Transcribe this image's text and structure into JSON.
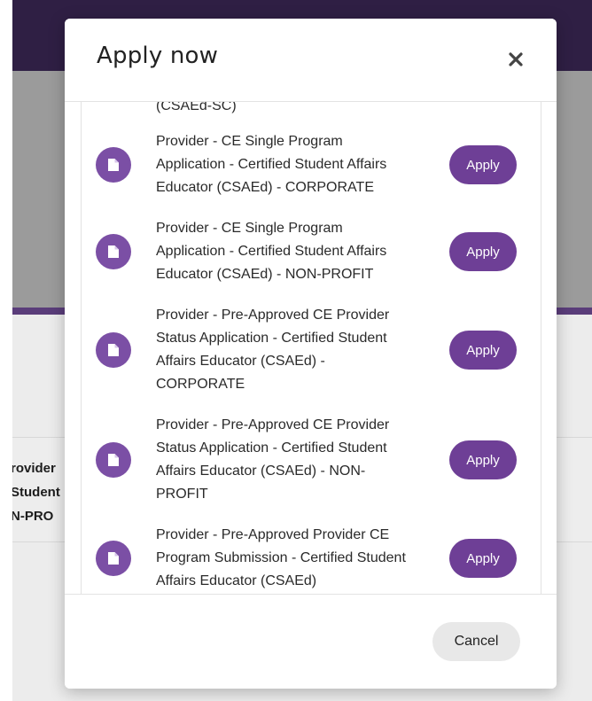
{
  "background": {
    "row_lines": [
      "rovider",
      "Student",
      "N-PRO"
    ]
  },
  "modal": {
    "title": "Apply now",
    "close_icon": "close-icon",
    "top_cut_text": "(CSAEd-SC)",
    "items": [
      {
        "icon": "document-icon",
        "lines": [
          "Provider - CE Single Program",
          "Application - Certified Student Affairs",
          "Educator (CSAEd) - CORPORATE"
        ],
        "button": "Apply"
      },
      {
        "icon": "document-icon",
        "lines": [
          "Provider - CE Single Program",
          "Application - Certified Student Affairs",
          "Educator (CSAEd) - NON-PROFIT"
        ],
        "button": "Apply"
      },
      {
        "icon": "document-icon",
        "lines": [
          "Provider - Pre-Approved CE Provider",
          "Status Application - Certified Student",
          "Affairs Educator (CSAEd) -",
          "CORPORATE"
        ],
        "button": "Apply"
      },
      {
        "icon": "document-icon",
        "lines": [
          "Provider - Pre-Approved CE Provider",
          "Status Application - Certified Student",
          "Affairs Educator (CSAEd) - NON-",
          "PROFIT"
        ],
        "button": "Apply"
      },
      {
        "icon": "document-icon",
        "lines": [
          "Provider - Pre-Approved Provider CE",
          "Program Submission - Certified Student",
          "Affairs Educator (CSAEd)"
        ],
        "button": "Apply"
      }
    ],
    "cancel_label": "Cancel"
  },
  "colors": {
    "accent": "#6e3f96",
    "icon_bg": "#7b4fa5",
    "header_bg": "#2f1f44"
  }
}
